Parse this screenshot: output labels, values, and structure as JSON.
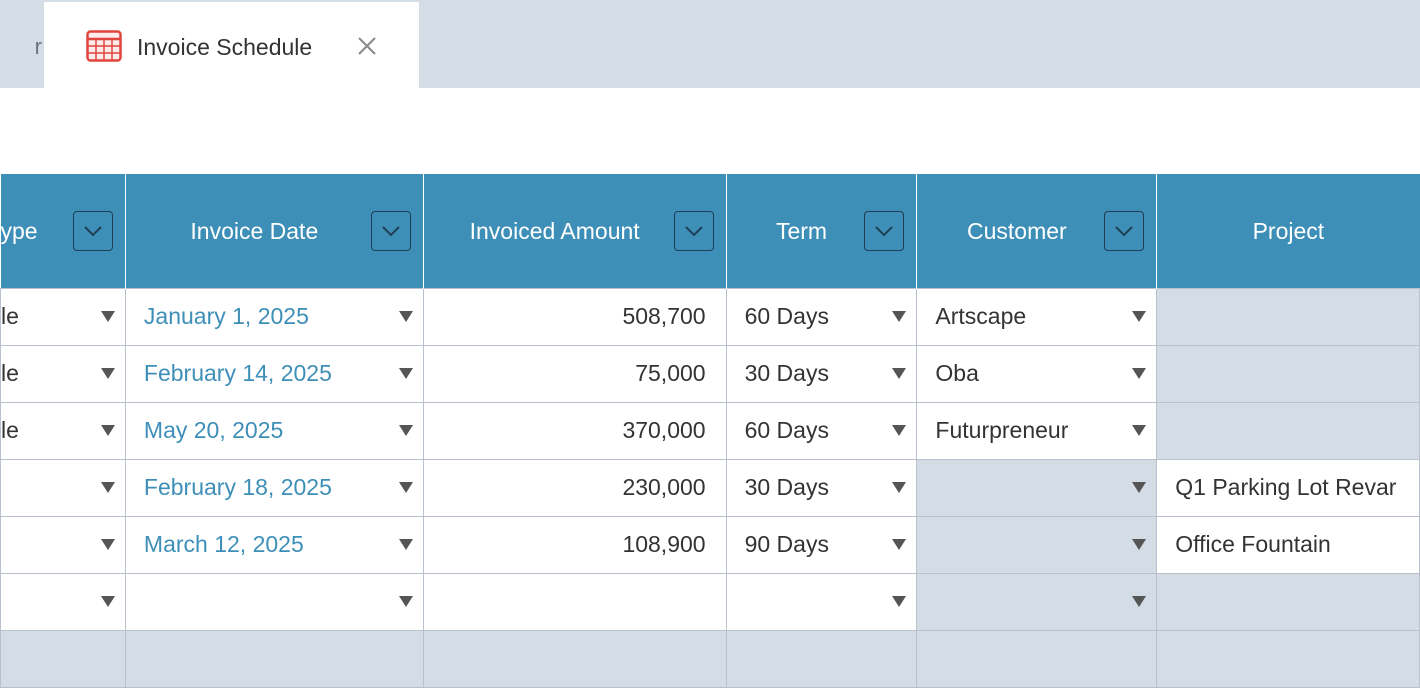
{
  "tabs": {
    "partial_glyph": "r",
    "active": {
      "label": "Invoice Schedule",
      "icon": "spreadsheet-icon"
    }
  },
  "columns": [
    {
      "key": "type",
      "label": "ype",
      "filter": true
    },
    {
      "key": "invoice_date",
      "label": "Invoice Date",
      "filter": true
    },
    {
      "key": "invoiced_amount",
      "label": "Invoiced Amount",
      "filter": true
    },
    {
      "key": "term",
      "label": "Term",
      "filter": true
    },
    {
      "key": "customer",
      "label": "Customer",
      "filter": true
    },
    {
      "key": "project",
      "label": "Project",
      "filter": false
    }
  ],
  "rows": [
    {
      "type": "le",
      "invoice_date": "January 1, 2025",
      "invoiced_amount": "508,700",
      "term": "60 Days",
      "customer": "Artscape",
      "project": ""
    },
    {
      "type": "le",
      "invoice_date": "February 14, 2025",
      "invoiced_amount": "75,000",
      "term": "30 Days",
      "customer": "Oba",
      "project": ""
    },
    {
      "type": "le",
      "invoice_date": "May 20, 2025",
      "invoiced_amount": "370,000",
      "term": "60 Days",
      "customer": "Futurpreneur",
      "project": ""
    },
    {
      "type": "",
      "invoice_date": "February 18, 2025",
      "invoiced_amount": "230,000",
      "term": "30 Days",
      "customer": "",
      "project": "Q1 Parking Lot Revar"
    },
    {
      "type": "",
      "invoice_date": "March 12, 2025",
      "invoiced_amount": "108,900",
      "term": "90 Days",
      "customer": "",
      "project": "Office Fountain"
    },
    {
      "type": "",
      "invoice_date": "",
      "invoiced_amount": "",
      "term": "",
      "customer": "",
      "project": ""
    },
    {
      "type": "",
      "invoice_date": "",
      "invoiced_amount": "",
      "term": "",
      "customer": "",
      "project": ""
    }
  ],
  "colors": {
    "header_bg": "#3e8fb8",
    "date_text": "#3e8fb8",
    "disabled_cell": "#d4dce6",
    "tab_bar": "#d4dce6"
  }
}
